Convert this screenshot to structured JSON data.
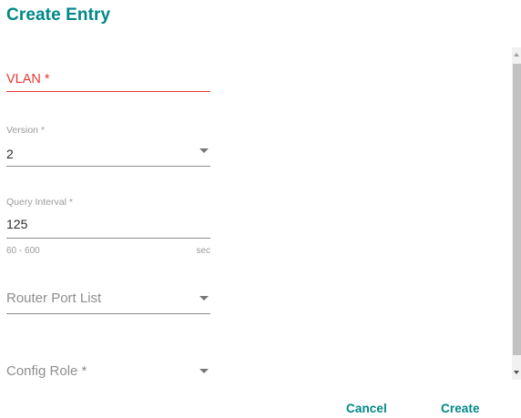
{
  "dialog": {
    "title": "Create Entry"
  },
  "form": {
    "vlan": {
      "label": "VLAN *",
      "value": ""
    },
    "version": {
      "label": "Version *",
      "value": "2"
    },
    "query_interval": {
      "label": "Query Interval *",
      "value": "125",
      "range_hint": "60 - 600",
      "unit": "sec"
    },
    "router_port_list": {
      "placeholder": "Router Port List",
      "value": ""
    },
    "config_role": {
      "placeholder": "Config Role *",
      "value": ""
    }
  },
  "actions": {
    "cancel_label": "Cancel",
    "create_label": "Create"
  },
  "colors": {
    "accent": "#008787",
    "error": "#e53935",
    "line": "#8c8c8c",
    "label_muted": "#9a9a9a"
  }
}
